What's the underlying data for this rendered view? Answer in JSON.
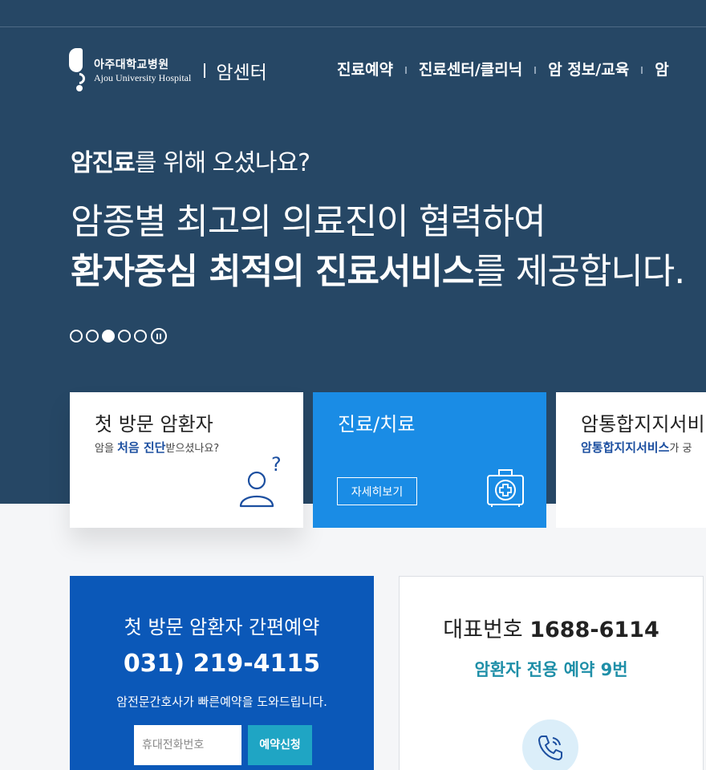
{
  "header": {
    "logo_ko": "아주대학교병원",
    "logo_en": "Ajou University Hospital",
    "center_name": "암센터",
    "nav": [
      "진료예약",
      "진료센터/클리닉",
      "암 정보/교육",
      "암"
    ]
  },
  "hero": {
    "sub_bold": "암진료",
    "sub_rest": "를 위해 오셨나요?",
    "line1": "암종별 최고의 의료진이 협력하여",
    "line2_bold": "환자중심 최적의 진료서비스",
    "line2_rest": "를 제공합니다.",
    "slides_total": 5,
    "slide_active": 3
  },
  "cards": {
    "first_visit": {
      "title": "첫 방문 암환자",
      "desc_pre": "암을 ",
      "desc_bold": "처음 진단",
      "desc_post": "받으셨나요?"
    },
    "treatment": {
      "title": "진료/치료",
      "button": "자세히보기"
    },
    "support": {
      "title": "암통합지지서비",
      "desc_bold": "암통합지지서비스",
      "desc_post": "가 궁"
    }
  },
  "reservation": {
    "title": "첫 방문 암환자 간편예약",
    "phone": "031) 219-4115",
    "note": "암전문간호사가 빠른예약을 도와드립니다.",
    "input_placeholder": "휴대전화번호",
    "button": "예약신청"
  },
  "representative": {
    "label": "대표번호",
    "number": "1688-6114",
    "sub": "암환자 전용 예약 9번"
  },
  "colors": {
    "hero_bg": "#264765",
    "card_active": "#1a8ce5",
    "reservation_bg": "#0b58b8",
    "accent_teal": "#1f8fa8"
  }
}
